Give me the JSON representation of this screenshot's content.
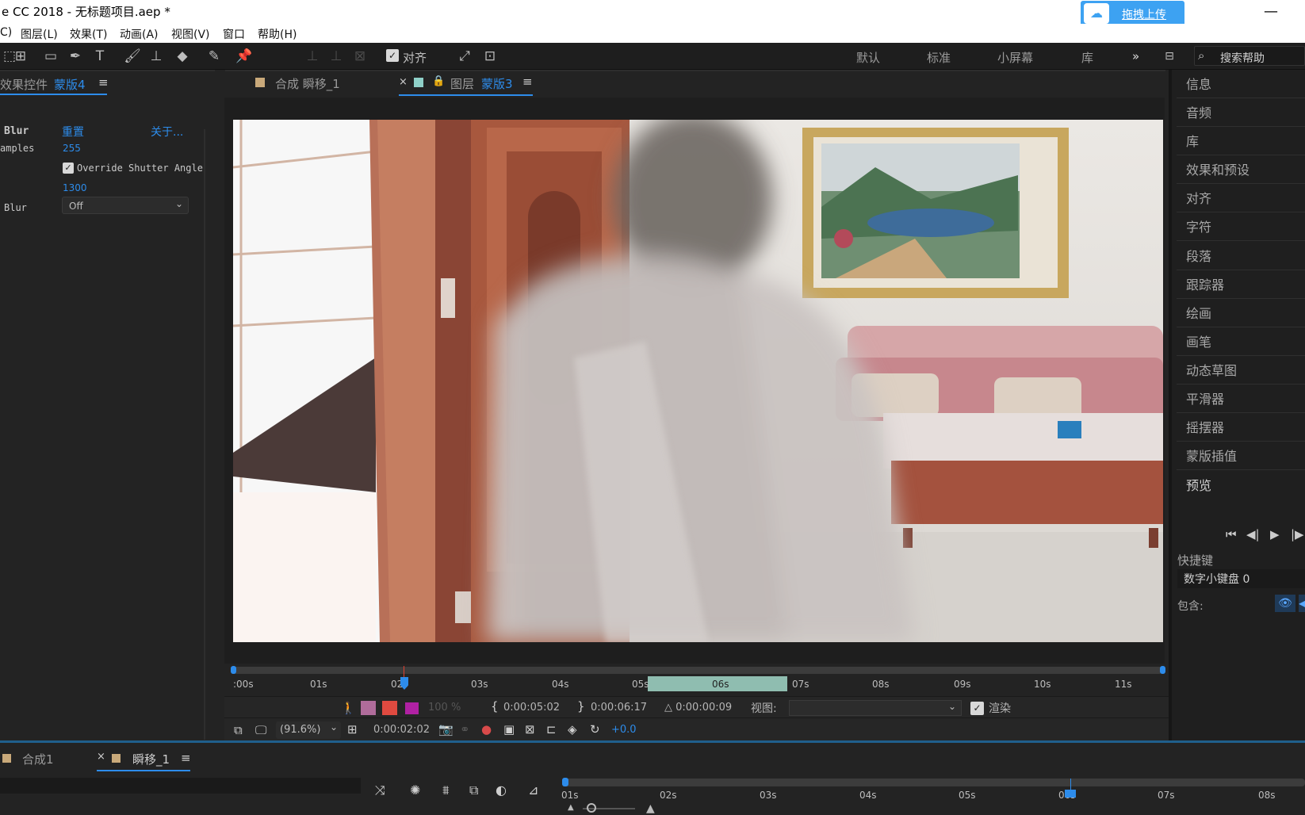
{
  "app": {
    "window_title": "e CC 2018 - 无标题项目.aep *",
    "upload_button": "拖拽上传",
    "minimize": "—"
  },
  "menu": [
    "C)",
    "图层(L)",
    "效果(T)",
    "动画(A)",
    "视图(V)",
    "窗口",
    "帮助(H)"
  ],
  "toolbar": {
    "align_label": "对齐",
    "workspaces": [
      "默认",
      "标准",
      "小屏幕",
      "库"
    ],
    "more": "»",
    "search_placeholder": "搜索帮助"
  },
  "effect_controls": {
    "tab_prefix": "效果控件",
    "tab_layer": "蒙版4",
    "menu_icon": "≡",
    "effect_name": "Blur",
    "reset": "重置",
    "about": "关于...",
    "samples_label": "amples",
    "samples_value": "255",
    "override_label": "Override Shutter Angle",
    "shutter_value": "1300",
    "blur_label": "Blur",
    "blur_value": "Off"
  },
  "viewer": {
    "tab_comp": "合成 瞬移_1",
    "tab_close": "×",
    "tab_layer_prefix": "图层",
    "tab_layer_name": "蒙版3",
    "menu_icon": "≡",
    "ruler_labels": [
      ":00s",
      "01s",
      "02s",
      "03s",
      "04s",
      "05s",
      "06s",
      "07s",
      "08s",
      "09s",
      "10s",
      "11s"
    ],
    "opacity": "100 %",
    "in_time": "0:00:05:02",
    "out_time": "0:00:06:17",
    "duration": "△ 0:00:00:09",
    "view_label": "视图:",
    "render_label": "渲染",
    "zoom": "(91.6%)",
    "current_time": "0:00:02:02",
    "exposure": "+0.0"
  },
  "right_panel": {
    "items": [
      "信息",
      "音频",
      "库",
      "效果和预设",
      "对齐",
      "字符",
      "段落",
      "跟踪器",
      "绘画",
      "画笔",
      "动态草图",
      "平滑器",
      "摇摆器",
      "蒙版插值",
      "预览"
    ],
    "shortcut_label": "快捷键",
    "shortcut_value": "数字小键盘 0",
    "include_label": "包含:"
  },
  "timeline": {
    "tab1": "合成1",
    "tab2_close": "×",
    "tab2": "瞬移_1",
    "menu_icon": "≡",
    "labels": [
      "01s",
      "02s",
      "03s",
      "04s",
      "05s",
      "06s",
      "07s",
      "08s"
    ]
  },
  "colors": {
    "accent": "#2d8ceb",
    "work_area": "#8fbdb0",
    "upload": "#3da2f2"
  }
}
